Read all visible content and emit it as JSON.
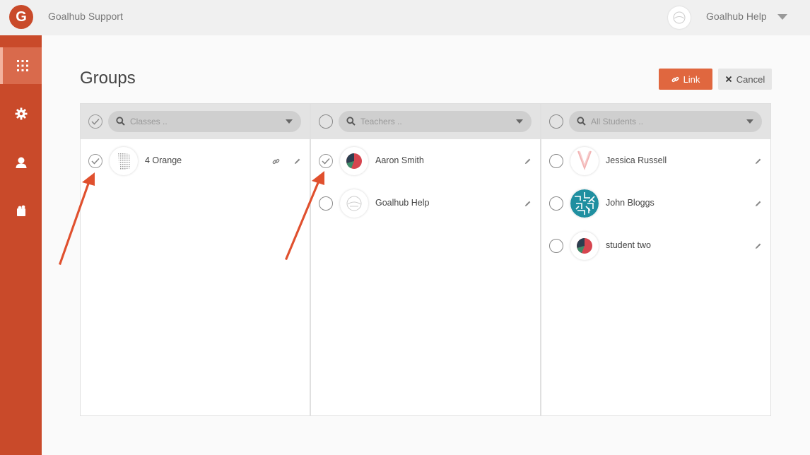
{
  "app": {
    "logo_letter": "G",
    "title": "Goalhub Support"
  },
  "user": {
    "name": "Goalhub Help"
  },
  "page": {
    "title": "Groups"
  },
  "actions": {
    "link_label": "Link",
    "cancel_label": "Cancel"
  },
  "colors": {
    "accent": "#c94a2a",
    "button": "#e0673f",
    "arrow": "#e0502e"
  },
  "sidebar": {
    "items": [
      {
        "icon": "grid-icon",
        "active": true
      },
      {
        "icon": "gear-icon",
        "active": false
      },
      {
        "icon": "user-icon",
        "active": false
      },
      {
        "icon": "puzzle-icon",
        "active": false
      }
    ]
  },
  "columns": [
    {
      "search_placeholder": "Classes ..",
      "header_checked": true,
      "rows": [
        {
          "label": "4 Orange",
          "checked": true,
          "avatar": "noise",
          "has_link": true
        }
      ]
    },
    {
      "search_placeholder": "Teachers ..",
      "header_checked": false,
      "rows": [
        {
          "label": "Aaron Smith",
          "checked": true,
          "avatar": "pie"
        },
        {
          "label": "Goalhub Help",
          "checked": false,
          "avatar": "sketch"
        }
      ]
    },
    {
      "search_placeholder": "All Students ..",
      "header_checked": false,
      "rows": [
        {
          "label": "Jessica Russell",
          "checked": false,
          "avatar": "vshape"
        },
        {
          "label": "John Bloggs",
          "checked": false,
          "avatar": "maze"
        },
        {
          "label": "student two",
          "checked": false,
          "avatar": "pie"
        }
      ]
    }
  ]
}
